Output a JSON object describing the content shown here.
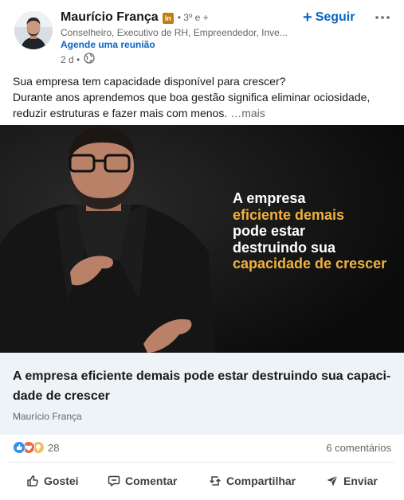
{
  "post": {
    "author": {
      "name": "Maurício França",
      "premium_badge_text": "in",
      "degree": "• 3º e +",
      "headline": "Conselheiro, Executivo de RH, Empreendedor, Inve...",
      "cta": "Agende uma reunião",
      "time": "2 d •",
      "visibility_icon": "globe-icon"
    },
    "follow_label": "Seguir",
    "follow_icon": "plus-icon",
    "more_icon": "more-options-icon",
    "text_lines": [
      "Sua empresa tem capacidade disponível para crescer?",
      "Durante anos aprendemos que boa gestão significa eliminar ociosidade,",
      "reduzir estruturas e fazer mais com menos."
    ],
    "see_more": "…mais",
    "image_overlay": {
      "line1": "A empresa",
      "line2": "eficiente demais",
      "line3": "pode estar",
      "line4": "destruindo sua",
      "line5": "capacidade de crescer"
    },
    "article": {
      "title_line1": "A empresa eficiente demais pode estar destruindo sua capaci-",
      "title_line2": "dade de crescer",
      "source": "Maurício França"
    },
    "reactions": {
      "icons": [
        "like-icon",
        "love-icon",
        "insightful-icon"
      ],
      "count": "28"
    },
    "comments": "6 comentários",
    "actions": [
      {
        "label": "Gostei",
        "icon": "like-outline-icon"
      },
      {
        "label": "Comentar",
        "icon": "comment-icon"
      },
      {
        "label": "Compartilhar",
        "icon": "repost-icon"
      },
      {
        "label": "Enviar",
        "icon": "send-icon"
      }
    ]
  },
  "colors": {
    "accent": "#0a66c2",
    "highlight": "#f2b33d",
    "premium": "#c37d16",
    "article_bg": "#eef3f8"
  }
}
